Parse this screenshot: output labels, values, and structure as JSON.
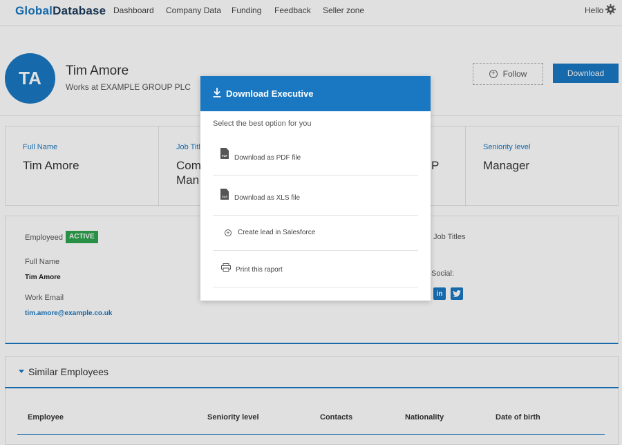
{
  "nav": {
    "logo_part1": "Global",
    "logo_part2": "Database",
    "items": [
      "Dashboard",
      "Company Data",
      "Funding",
      "Feedback",
      "Seller zone"
    ],
    "greeting": "Hello"
  },
  "profile": {
    "initials": "TA",
    "name": "Tim Amore",
    "works_at": "Works at EXAMPLE GROUP PLC",
    "follow_label": "Follow",
    "download_label": "Download"
  },
  "cards": [
    {
      "label": "Full Name",
      "value": "Tim Amore"
    },
    {
      "label": "Job Titl",
      "value": "Com Man"
    },
    {
      "label": "",
      "value": "P"
    },
    {
      "label": "Seniority level",
      "value": "Manager"
    }
  ],
  "details": {
    "employeed_label": "Employeed",
    "status_badge": "ACTIVE",
    "full_name_label": "Full Name",
    "full_name_value": "Tim Amore",
    "work_email_label": "Work Email",
    "work_email_value": "tim.amore@example.co.uk",
    "job_titles_label": "Job Titles",
    "social_label": "Social:",
    "social_icons": [
      "linkedin-icon",
      "twitter-icon"
    ]
  },
  "similar": {
    "title": "Similar Employees",
    "columns": [
      "Employee",
      "Seniority level",
      "Contacts",
      "Nationality",
      "Date of birth"
    ]
  },
  "modal": {
    "title": "Download Executive",
    "subtitle": "Select the best option for you",
    "options": [
      {
        "label": "Download as PDF file",
        "icon": "pdf-file-icon",
        "badge": "PDF"
      },
      {
        "label": "Download as XLS file",
        "icon": "xls-file-icon",
        "badge": "XLS"
      },
      {
        "label": "Create lead in Salesforce",
        "icon": "circle-plus-icon"
      },
      {
        "label": "Print this raport",
        "icon": "printer-icon"
      }
    ]
  },
  "colors": {
    "accent": "#1a78c2",
    "active_badge": "#2ea44f"
  }
}
